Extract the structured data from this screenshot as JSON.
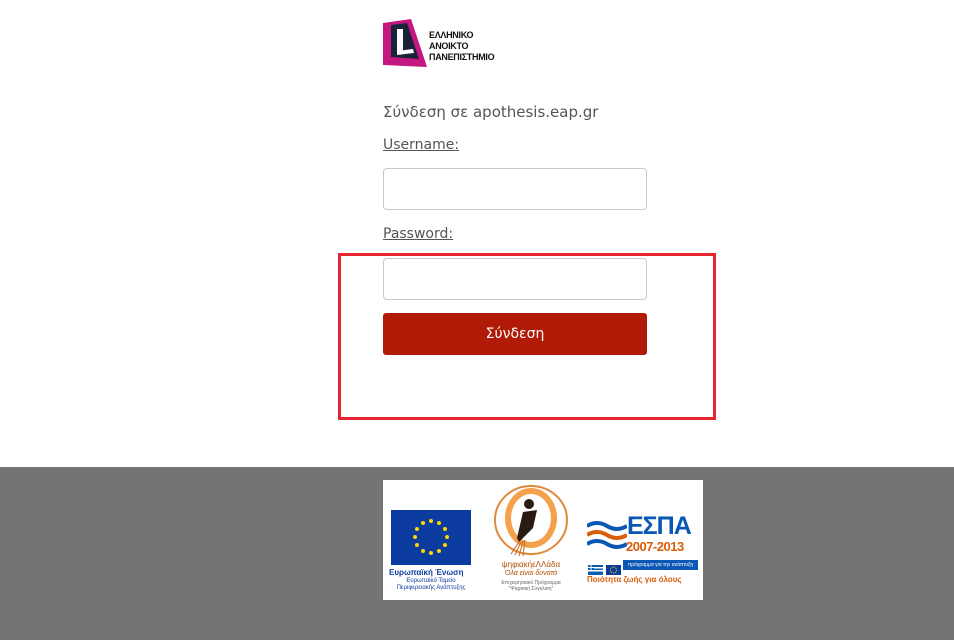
{
  "logo": {
    "name_lines": [
      "ΕΛΛΗΝΙΚΟ",
      "ΑΝΟΙΚΤΟ",
      "ΠΑΝΕΠΙΣΤΗΜΙΟ"
    ],
    "colors": {
      "magenta": "#c4177f",
      "navy": "#1a2238"
    }
  },
  "login": {
    "heading": "Σύνδεση σε apothesis.eap.gr",
    "username_label": "Username:",
    "username_value": "",
    "password_label": "Password:",
    "password_value": "",
    "submit_label": "Σύνδεση"
  },
  "footer": {
    "eu": {
      "title": "Ευρωπαϊκή Ένωση",
      "subtitle_lines": [
        "Ευρωπαϊκό Ταμείο",
        "Περιφερειακής Ανάπτυξης"
      ]
    },
    "digital_greece": {
      "title": "ψηφιακήεΛΛάδα",
      "slogan": "Όλα είναι δυνατά",
      "program_lines": [
        "Επιχειρησιακό Πρόγραμμα",
        "\"Ψηφιακή Σύγκλιση\""
      ]
    },
    "espa": {
      "title": "ΕΣΠΑ",
      "years": "2007-2013",
      "bar": "πρόγραμμα για την ανάπτυξη",
      "slogan": "Ποιότητα ζωής για όλους"
    }
  },
  "colors": {
    "button": "#b11a06",
    "highlight": "#e3252d",
    "footer_bg": "#747474"
  }
}
